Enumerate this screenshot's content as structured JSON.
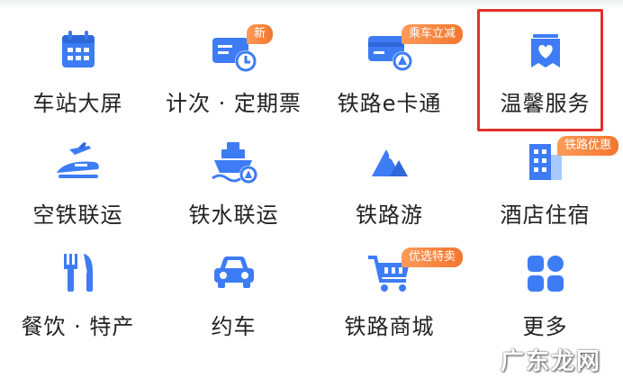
{
  "colors": {
    "icon_primary": "#3d7cf5",
    "icon_light": "#a9c8ff",
    "badge": "#f2762e",
    "highlight": "#e0302a"
  },
  "grid": [
    {
      "label": "车站大屏",
      "icon": "calendar-screen-icon"
    },
    {
      "label": "计次 · 定期票",
      "icon": "ticket-clock-icon",
      "badge": "新"
    },
    {
      "label": "铁路e卡通",
      "icon": "rail-card-icon",
      "badge": "乘车立减"
    },
    {
      "label": "温馨服务",
      "icon": "heart-service-icon"
    },
    {
      "label": "空铁联运",
      "icon": "plane-train-icon"
    },
    {
      "label": "铁水联运",
      "icon": "ship-rail-icon"
    },
    {
      "label": "铁路游",
      "icon": "mountain-travel-icon"
    },
    {
      "label": "酒店住宿",
      "icon": "hotel-building-icon",
      "badge": "铁路优惠"
    },
    {
      "label": "餐饮 · 特产",
      "icon": "fork-knife-icon"
    },
    {
      "label": "约车",
      "icon": "car-icon"
    },
    {
      "label": "铁路商城",
      "icon": "shopping-cart-icon",
      "badge": "优选特卖"
    },
    {
      "label": "更多",
      "icon": "more-grid-icon"
    }
  ],
  "watermark": "广东龙网"
}
